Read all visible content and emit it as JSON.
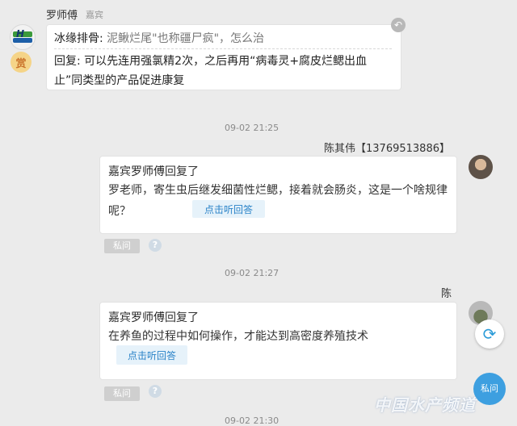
{
  "message1": {
    "sender_name": "罗师傅",
    "sender_role": "嘉宾",
    "recall_icon": "undo-icon",
    "reward_badge": "赏",
    "question_prefix": "冰缘排骨:",
    "question_quote": "泥鳅烂尾\"也称疆尸疯\"，怎么治",
    "reply_text": "回复: 可以先连用强氯精2次，之后再用“病毒灵+腐皮烂鳃出血止”同类型的产品促进康复"
  },
  "message2": {
    "time": "09-02 21:25",
    "sender": "陈其伟【13769513886】",
    "header_prefix": "嘉宾",
    "header_name": "罗师傅",
    "header_suffix": "回复了",
    "body": "罗老师，寄生虫后继发细菌性烂鳃，接着就会肠炎，这是一个啥规律呢？",
    "listen_button": "点击听回答",
    "private_button": "私问",
    "help_icon": "?"
  },
  "message3": {
    "time": "09-02 21:27",
    "sender": "陈",
    "header_prefix": "嘉宾",
    "header_name": "罗师傅",
    "header_suffix": "回复了",
    "body": "在养鱼的过程中如何操作，才能达到高密度养殖技术",
    "listen_button": "点击听回答",
    "private_button": "私问",
    "help_icon": "?"
  },
  "footer": {
    "time": "09-02 21:30",
    "fab_label": "私问",
    "refresh_icon": "refresh-icon",
    "watermark": "中国水产频道"
  },
  "colors": {
    "background": "#ebebeb",
    "accent": "#2a83c8",
    "fab": "#3d9fe0"
  }
}
